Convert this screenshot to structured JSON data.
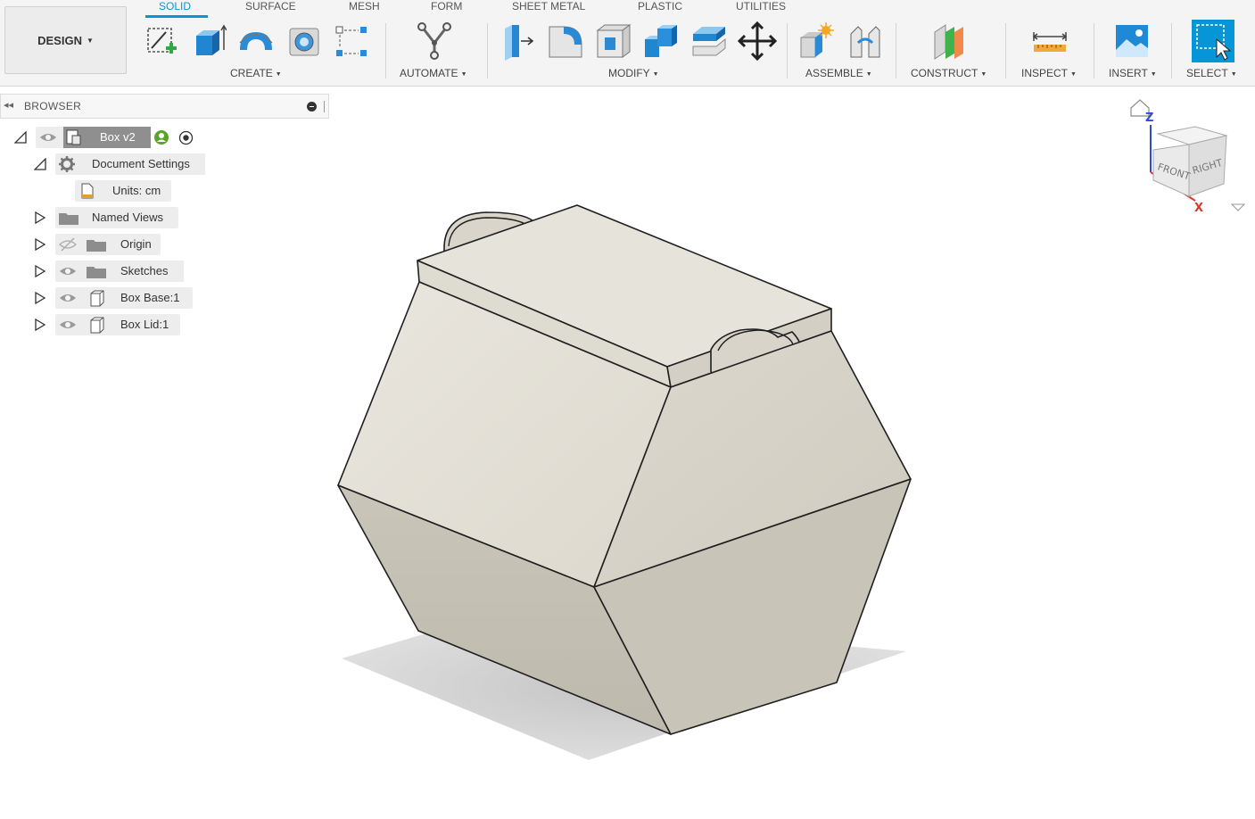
{
  "design_menu": {
    "label": "DESIGN"
  },
  "tabs": [
    "SOLID",
    "SURFACE",
    "MESH",
    "FORM",
    "SHEET METAL",
    "PLASTIC",
    "UTILITIES"
  ],
  "active_tab": "SOLID",
  "groups": {
    "create": "CREATE",
    "automate": "AUTOMATE",
    "modify": "MODIFY",
    "assemble": "ASSEMBLE",
    "construct": "CONSTRUCT",
    "inspect": "INSPECT",
    "insert": "INSERT",
    "select": "SELECT"
  },
  "browser": {
    "title": "BROWSER",
    "root": {
      "label": "Box v2"
    },
    "items": [
      {
        "label": "Document Settings"
      },
      {
        "label": "Units: cm"
      },
      {
        "label": "Named Views"
      },
      {
        "label": "Origin"
      },
      {
        "label": "Sketches"
      },
      {
        "label": "Box Base:1"
      },
      {
        "label": "Box Lid:1"
      }
    ]
  },
  "viewcube": {
    "front": "FRONT",
    "right": "RIGHT",
    "axis_z": "Z",
    "axis_x": "X"
  },
  "colors": {
    "accent": "#0696d7",
    "model_light": "#e7e4dc",
    "model_mid": "#d5d1c5",
    "model_dark": "#c0bcb0"
  }
}
